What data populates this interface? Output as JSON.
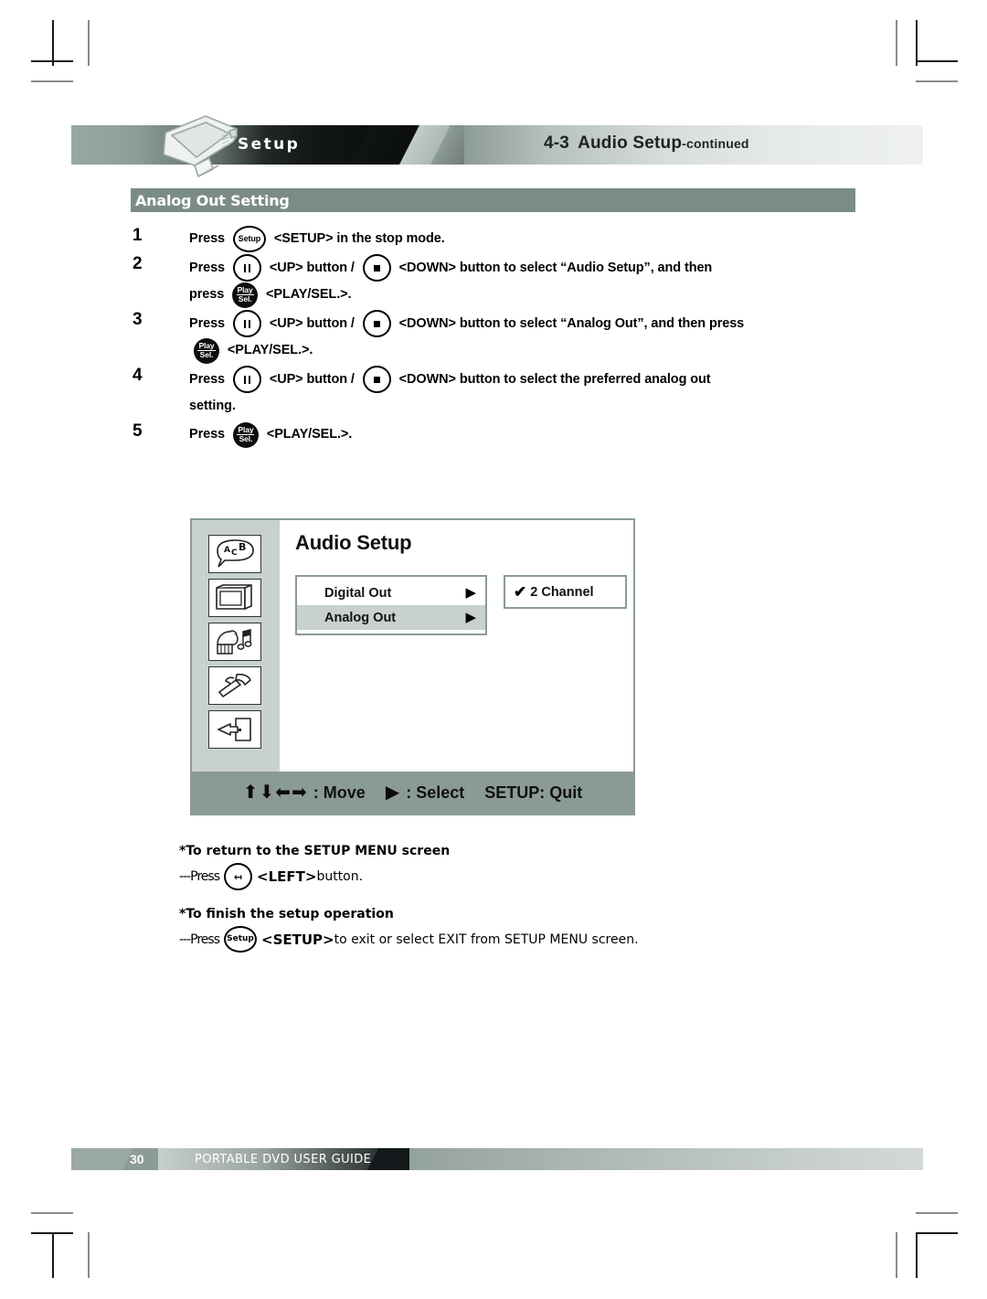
{
  "header": {
    "tab_label": "Setup",
    "section_number": "4-3",
    "title": "Audio Setup",
    "title_suffix": "-continued",
    "device_icon": "portable-dvd-player-icon"
  },
  "section": {
    "bar_title": "Analog Out Setting"
  },
  "steps": [
    {
      "number": "1",
      "lines": [
        {
          "parts": [
            {
              "type": "text",
              "value": "Press "
            },
            {
              "type": "key",
              "style": "oval",
              "glyph": "Setup",
              "name": "setup-key-icon"
            },
            {
              "type": "text",
              "value": " <SETUP> in the stop mode."
            }
          ]
        }
      ]
    },
    {
      "number": "2",
      "lines": [
        {
          "parts": [
            {
              "type": "text",
              "value": "Press "
            },
            {
              "type": "key",
              "style": "circle-pause",
              "glyph": "‖",
              "name": "up-key-icon"
            },
            {
              "type": "text",
              "value": " <UP> button / "
            },
            {
              "type": "key",
              "style": "circle-stop",
              "glyph": "■",
              "name": "down-key-icon"
            },
            {
              "type": "text",
              "value": " <DOWN> button to select “Audio Setup”, and then"
            }
          ]
        },
        {
          "parts": [
            {
              "type": "text",
              "value": "press "
            },
            {
              "type": "key",
              "style": "black",
              "glyph": "Play/Sel.",
              "name": "play-sel-key-icon"
            },
            {
              "type": "text",
              "value": " <PLAY/SEL.>."
            }
          ]
        }
      ]
    },
    {
      "number": "3",
      "lines": [
        {
          "parts": [
            {
              "type": "text",
              "value": "Press "
            },
            {
              "type": "key",
              "style": "circle-pause",
              "glyph": "‖",
              "name": "up-key-icon"
            },
            {
              "type": "text",
              "value": " <UP> button / "
            },
            {
              "type": "key",
              "style": "circle-stop",
              "glyph": "■",
              "name": "down-key-icon"
            },
            {
              "type": "text",
              "value": " <DOWN> button to select “Analog Out”, and then press"
            }
          ]
        },
        {
          "parts": [
            {
              "type": "key",
              "style": "black",
              "glyph": "Play/Sel.",
              "name": "play-sel-key-icon"
            },
            {
              "type": "text",
              "value": " <PLAY/SEL.>."
            }
          ]
        }
      ]
    },
    {
      "number": "4",
      "lines": [
        {
          "parts": [
            {
              "type": "text",
              "value": "Press "
            },
            {
              "type": "key",
              "style": "circle-pause",
              "glyph": "‖",
              "name": "up-key-icon"
            },
            {
              "type": "text",
              "value": " <UP> button / "
            },
            {
              "type": "key",
              "style": "circle-stop",
              "glyph": "■",
              "name": "down-key-icon"
            },
            {
              "type": "text",
              "value": " <DOWN> button to select the preferred analog out"
            }
          ]
        },
        {
          "parts": [
            {
              "type": "text",
              "value": "setting."
            }
          ]
        }
      ]
    },
    {
      "number": "5",
      "lines": [
        {
          "parts": [
            {
              "type": "text",
              "value": "Press "
            },
            {
              "type": "key",
              "style": "black",
              "glyph": "Play/Sel.",
              "name": "play-sel-key-icon"
            },
            {
              "type": "text",
              "value": " <PLAY/SEL.>."
            }
          ]
        }
      ]
    }
  ],
  "osd": {
    "title": "Audio Setup",
    "sidebar_icons": [
      {
        "name": "language-speech-bubble-icon",
        "label": "A C B"
      },
      {
        "name": "display-tv-icon",
        "label": "TV"
      },
      {
        "name": "audio-gramophone-icon",
        "label": "Audio"
      },
      {
        "name": "setup-hammer-icon",
        "label": "Setup"
      },
      {
        "name": "exit-door-icon",
        "label": "Exit"
      }
    ],
    "menu_items": [
      {
        "label": "Digital Out",
        "arrow": "▶",
        "selected": false
      },
      {
        "label": "Analog Out",
        "arrow": "▶",
        "selected": true
      }
    ],
    "option": {
      "check": "✔",
      "label": "2 Channel",
      "checked": true
    },
    "footer": {
      "move_arrows": "⬆⬇⬅➡",
      "move_label": ": Move",
      "select_arrow": "▶",
      "select_label": ": Select",
      "quit_label": "SETUP: Quit"
    }
  },
  "notes": [
    {
      "heading": "*To return to the SETUP MENU screen",
      "prefix": "---Press",
      "key_style": "circle-left",
      "key_glyph": "↤",
      "key_name": "left-key-icon",
      "bold": "<LEFT>",
      "rest": " button."
    },
    {
      "heading": "*To finish the setup operation",
      "prefix": "---Press",
      "key_style": "oval",
      "key_glyph": "Setup",
      "key_name": "setup-key-icon",
      "bold": "<SETUP>",
      "rest": " to exit or select EXIT from SETUP MENU screen."
    }
  ],
  "page_footer": {
    "page_number": "30",
    "guide_title": "PORTABLE DVD USER GUIDE"
  },
  "colors": {
    "teal_bar": "#7b8c88",
    "osd_sidebar": "#c8d1cf",
    "osd_footer": "#8a9a97",
    "osd_border": "#8a9a97"
  }
}
